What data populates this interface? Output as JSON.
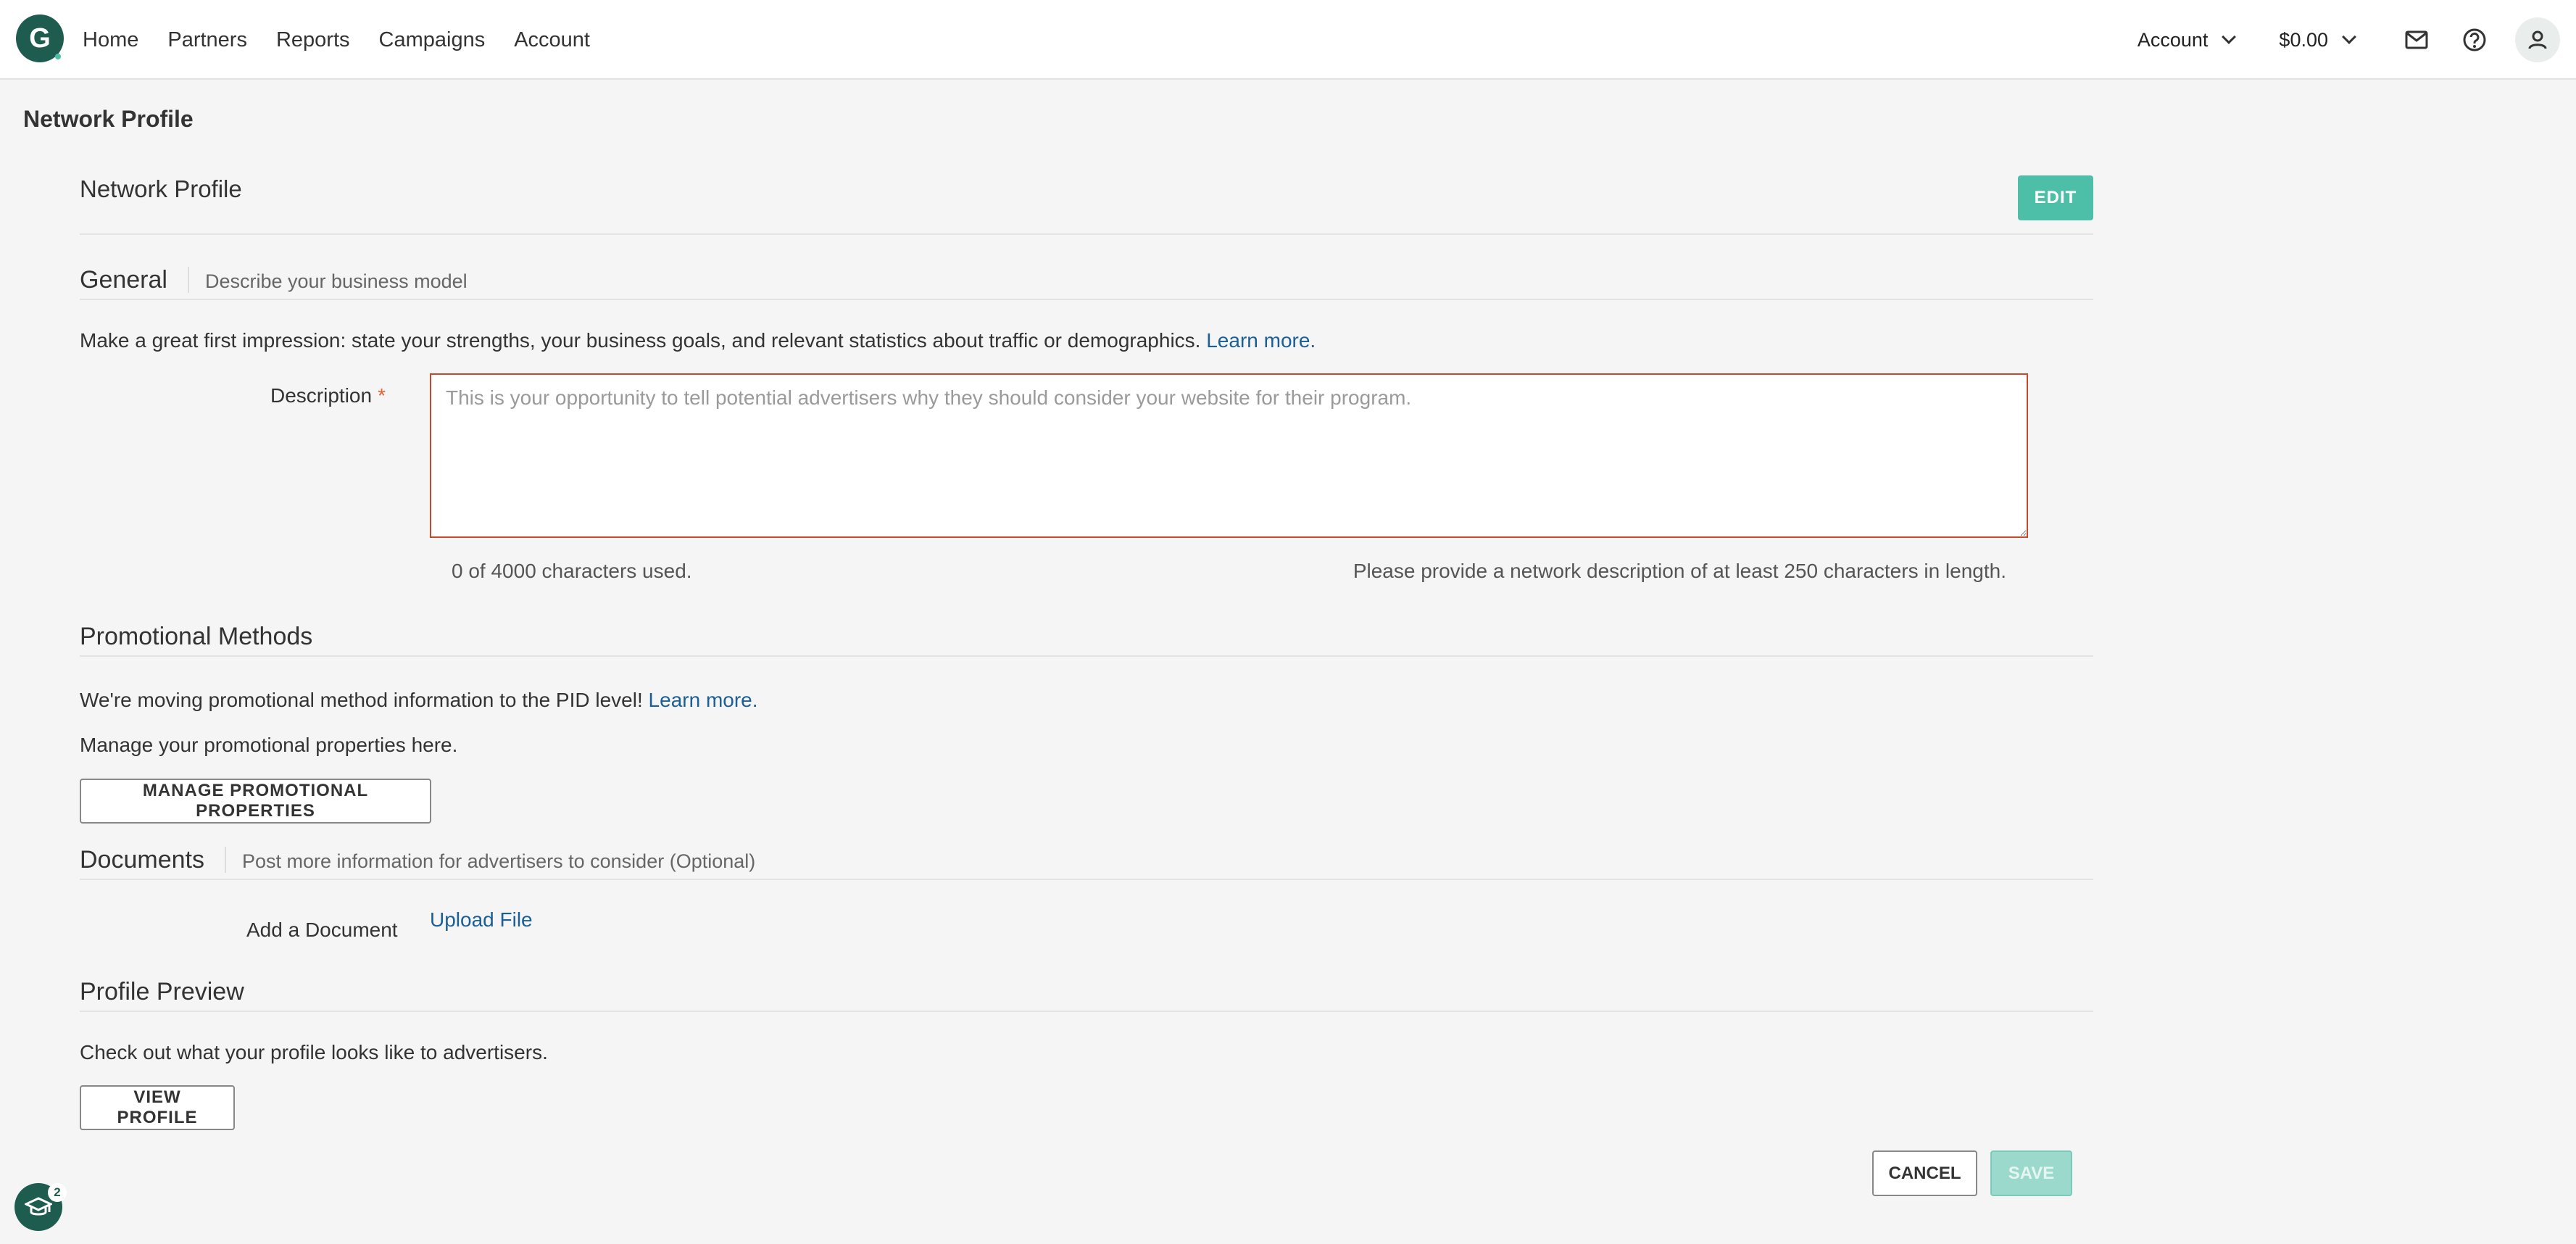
{
  "nav": {
    "logo_letter": "G",
    "links": [
      "Home",
      "Partners",
      "Reports",
      "Campaigns",
      "Account"
    ],
    "account_menu": "Account",
    "balance": "$0.00",
    "icons": [
      "mail-icon",
      "help-icon",
      "user-icon"
    ]
  },
  "page": {
    "title": "Network Profile"
  },
  "card": {
    "title": "Network Profile",
    "edit_label": "EDIT"
  },
  "general": {
    "title": "General",
    "subtitle": "Describe your business model",
    "intro": "Make a great first impression: state your strengths, your business goals, and relevant statistics about traffic or demographics.",
    "learn_more": "Learn more.",
    "description_label": "Description",
    "required_mark": "*",
    "description_value": "",
    "description_placeholder": "This is your opportunity to tell potential advertisers why they should consider your website for their program.",
    "counter": "0 of 4000 characters used.",
    "hint": "Please provide a network description of at least 250 characters in length."
  },
  "promotional": {
    "title": "Promotional Methods",
    "notice": "We're moving promotional method information to the PID level!",
    "learn_more": "Learn more.",
    "manage_text": "Manage your promotional properties here.",
    "manage_button": "MANAGE PROMOTIONAL PROPERTIES"
  },
  "documents": {
    "title": "Documents",
    "subtitle": "Post more information for advertisers to consider (Optional)",
    "add_label": "Add a Document",
    "upload_link": "Upload File"
  },
  "preview": {
    "title": "Profile Preview",
    "text": "Check out what your profile looks like to advertisers.",
    "view_button": "VIEW PROFILE"
  },
  "footer": {
    "cancel_label": "CANCEL",
    "save_label": "SAVE"
  },
  "help": {
    "badge_count": "2"
  },
  "colors": {
    "accent": "#4dbfa8",
    "brand": "#1f5c50",
    "link": "#1a5f95",
    "error": "#c8472b"
  }
}
